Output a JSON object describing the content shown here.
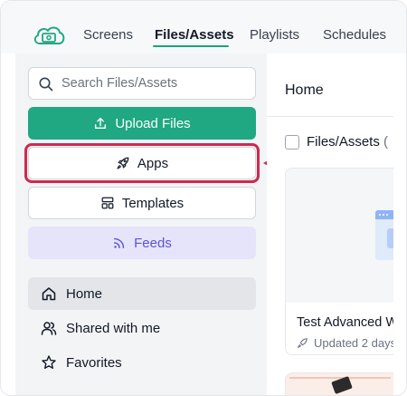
{
  "nav": {
    "tabs": [
      {
        "label": "Screens"
      },
      {
        "label": "Files/Assets",
        "active": true
      },
      {
        "label": "Playlists"
      },
      {
        "label": "Schedules"
      }
    ]
  },
  "sidebar": {
    "search_placeholder": "Search Files/Assets",
    "upload_label": "Upload Files",
    "apps_label": "Apps",
    "templates_label": "Templates",
    "feeds_label": "Feeds",
    "items": [
      {
        "label": "Home",
        "icon": "home-icon",
        "active": true
      },
      {
        "label": "Shared with me",
        "icon": "people-icon"
      },
      {
        "label": "Favorites",
        "icon": "star-icon"
      }
    ]
  },
  "main": {
    "title": "Home",
    "files_label": "Files/Assets",
    "files_count_prefix": "(",
    "card": {
      "title": "Test Advanced W",
      "meta": "Updated 2 days"
    }
  },
  "colors": {
    "accent": "#1fa882",
    "feeds_bg": "#e6e4fb",
    "feeds_text": "#5b53d6",
    "highlight": "#d0284f"
  }
}
